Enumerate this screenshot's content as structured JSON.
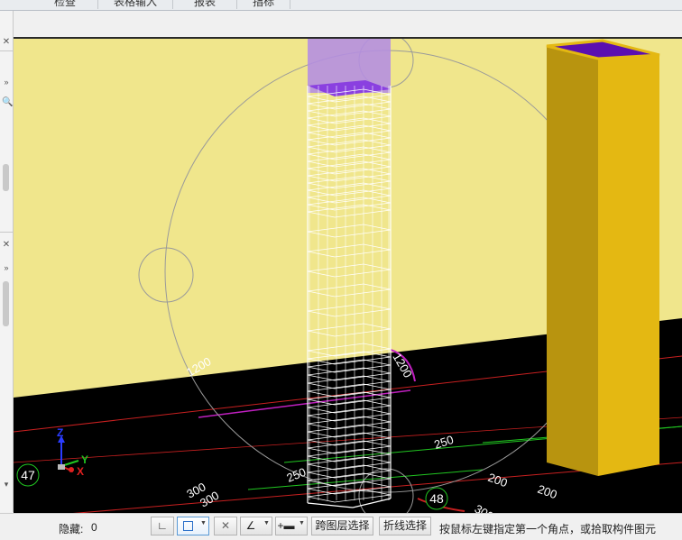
{
  "tabs": [
    {
      "label": "检查"
    },
    {
      "label": "表格输入"
    },
    {
      "label": "报表"
    },
    {
      "label": "指标"
    }
  ],
  "viewport": {
    "grid_dims": [
      "250",
      "250",
      "300",
      "300",
      "1200",
      "1200",
      "200",
      "200",
      "300"
    ],
    "axis_bubbles": [
      "47",
      "48"
    ],
    "axes": {
      "x": "X",
      "y": "Y",
      "z": "Z"
    },
    "colors": {
      "wall": "#f0e68c",
      "floor": "#000000",
      "column_front": "#e4b812",
      "column_side": "#b8940f",
      "column_top": "#5b0fb0",
      "rebar": "#ffffff",
      "orbit_ring": "#9a9a9a",
      "axis_line_red": "#c82020",
      "axis_line_green": "#21c721",
      "axis_line_magenta": "#c020c0"
    }
  },
  "statusbar": {
    "hidden_label": "隐藏:",
    "hidden_value": "0",
    "cross_layer_select": "跨图层选择",
    "polyline_select": "折线选择",
    "hint": "按鼠标左键指定第一个角点，或拾取构件图元"
  }
}
